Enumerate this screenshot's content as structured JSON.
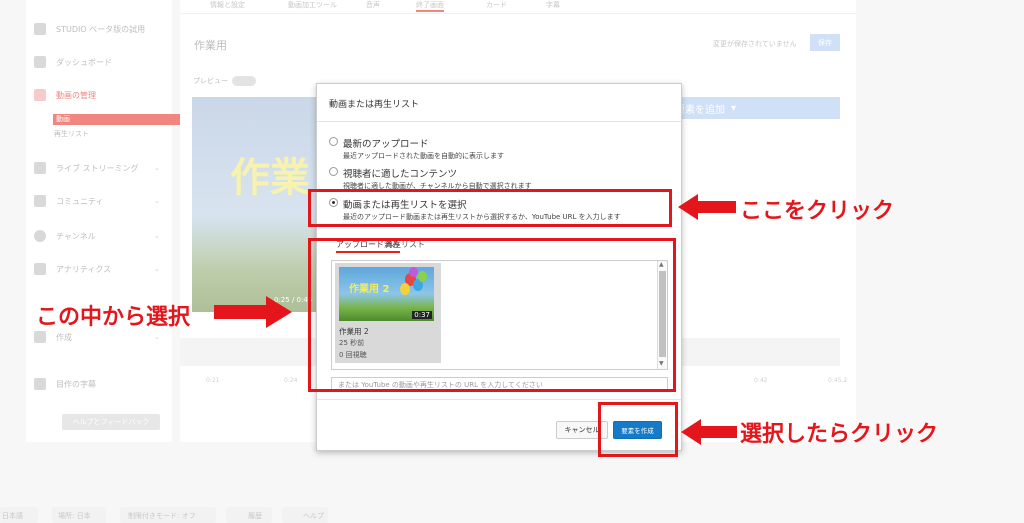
{
  "sidebar": {
    "items": [
      {
        "label": "STUDIO ベータ版の試用"
      },
      {
        "label": "ダッシュボード"
      },
      {
        "label": "動画の管理"
      },
      {
        "label": "ライブ ストリーミング"
      },
      {
        "label": "コミュニティ"
      },
      {
        "label": "チャンネル"
      },
      {
        "label": "アナリティクス"
      },
      {
        "label": "作成"
      },
      {
        "label": "目作の字幕"
      }
    ],
    "subitems": [
      "動画",
      "再生リスト"
    ],
    "help_button": "ヘルプとフィードバック"
  },
  "topnav": [
    "情報と設定",
    "動画加工ツール",
    "音声",
    "終了画面",
    "カード",
    "字幕"
  ],
  "editor": {
    "title": "作業用",
    "save_status": "変更が保存されていません",
    "save_label": "保存",
    "preview_label": "プレビュー",
    "video_overlay_title": "作業",
    "video_time": "0:25 / 0:45",
    "add_element_label": "要素を追加",
    "timeline_ticks": [
      "0:21",
      "0:24",
      "0:42",
      "0:45.2"
    ]
  },
  "modal": {
    "title": "動画または再生リスト",
    "options": [
      {
        "label": "最新のアップロード",
        "desc": "最近アップロードされた動画を自動的に表示します",
        "checked": false
      },
      {
        "label": "視聴者に適したコンテンツ",
        "desc": "視聴者に適した動画が、チャンネルから自動で選択されます",
        "checked": false
      },
      {
        "label": "動画または再生リストを選択",
        "desc": "最近のアップロード動画または再生リストから選択するか、YouTube URL を入力します",
        "checked": true
      }
    ],
    "tabs": [
      "アップロード済み",
      "再生リスト"
    ],
    "card": {
      "thumb_title": "作業用 2",
      "duration": "0:37",
      "title": "作業用 2",
      "age": "25 秒前",
      "views": "0 回視聴"
    },
    "url_placeholder": "または YouTube の動画や再生リストの URL を入力してください",
    "cancel_label": "キャンセル",
    "create_label": "要素を作成"
  },
  "annotations": {
    "click_here": "ここをクリック",
    "select_inside": "この中から選択",
    "click_after": "選択したらクリック",
    "color": "#e4161c"
  },
  "footer": [
    "日本語",
    "場所: 日本",
    "制限付きモード: オフ",
    "履歴",
    "ヘルプ"
  ]
}
